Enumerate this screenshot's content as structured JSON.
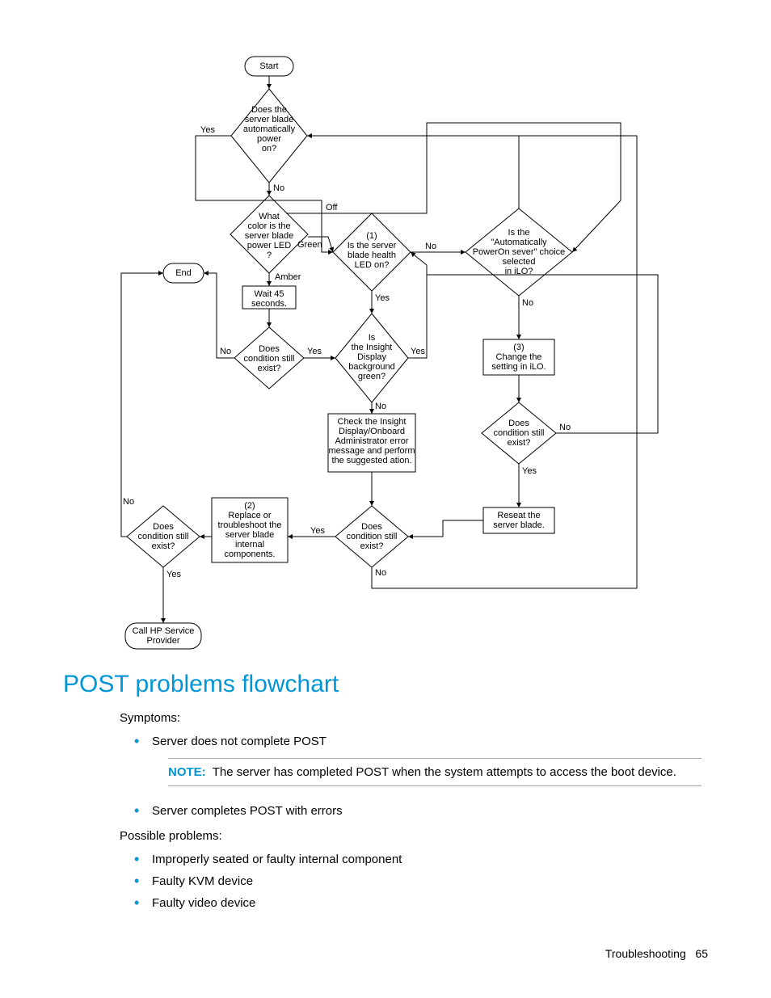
{
  "flow": {
    "start": "Start",
    "q_autopower": "Does the\nserver blade\nautomatically\npower\non?",
    "q_ledcolor": "What\ncolor is the\nserver blade\npower LED\n?",
    "end": "End",
    "wait": "Wait 45\nseconds.",
    "q_condexist1": "Does\ncondition still\nexist?",
    "q_health": "(1)\nIs the server\nblade health\nLED on?",
    "q_iloset": "Is the\n\"Automatically\nPowerOn sever\" choice\nselected\nin iLO?",
    "q_insight": "Is\nthe Insight\nDisplay\nbackground\ngreen?",
    "changeilo": "(3)\nChange the\nsetting in iLO.",
    "checkins": "Check the Insight\nDisplay/Onboard\nAdministrator error\nmessage and perform\nthe suggested ation.",
    "q_condexist_ilo": "Does\ncondition still\nexist?",
    "replace": "(2)\nReplace or\ntroubleshoot the\nserver blade\ninternal\ncomponents.",
    "q_condexist2": "Does\ncondition still\nexist?",
    "reseat": "Reseat the\nserver blade.",
    "q_condexist3": "Does\ncondition still\nexist?",
    "callhp": "Call HP Service\nProvider",
    "lbl": {
      "yes": "Yes",
      "no": "No",
      "off": "Off",
      "green": "Green",
      "amber": "Amber"
    }
  },
  "heading": "POST problems flowchart",
  "symptoms_label": "Symptoms:",
  "symptoms": [
    "Server does not complete POST",
    "Server completes POST with errors"
  ],
  "note_label": "NOTE:",
  "note": "The server has completed POST when the system attempts to access the boot device.",
  "problems_label": "Possible problems:",
  "problems": [
    "Improperly seated or faulty internal component",
    "Faulty KVM device",
    "Faulty video device"
  ],
  "footer_section": "Troubleshooting",
  "footer_page": "65",
  "chart_data": {
    "type": "flowchart",
    "nodes": [
      {
        "id": "start",
        "shape": "terminator",
        "text": "Start"
      },
      {
        "id": "q_autopower",
        "shape": "decision",
        "text": "Does the server blade automatically power on?"
      },
      {
        "id": "q_ledcolor",
        "shape": "decision",
        "text": "What color is the server blade power LED ?"
      },
      {
        "id": "end",
        "shape": "terminator",
        "text": "End"
      },
      {
        "id": "wait",
        "shape": "process",
        "text": "Wait 45 seconds."
      },
      {
        "id": "q_condexist1",
        "shape": "decision",
        "text": "Does condition still exist?"
      },
      {
        "id": "q_health",
        "shape": "decision",
        "text": "(1) Is the server blade health LED on?"
      },
      {
        "id": "q_iloset",
        "shape": "decision",
        "text": "Is the \"Automatically PowerOn sever\" choice selected in iLO?"
      },
      {
        "id": "q_insight",
        "shape": "decision",
        "text": "Is the Insight Display background green?"
      },
      {
        "id": "changeilo",
        "shape": "process",
        "text": "(3) Change the setting in iLO."
      },
      {
        "id": "checkins",
        "shape": "process",
        "text": "Check the Insight Display/Onboard Administrator error message and perform the suggested ation."
      },
      {
        "id": "q_condexist_ilo",
        "shape": "decision",
        "text": "Does condition still exist?"
      },
      {
        "id": "replace",
        "shape": "process",
        "text": "(2) Replace or troubleshoot the server blade internal components."
      },
      {
        "id": "q_condexist2",
        "shape": "decision",
        "text": "Does condition still exist?"
      },
      {
        "id": "reseat",
        "shape": "process",
        "text": "Reseat the server blade."
      },
      {
        "id": "q_condexist3",
        "shape": "decision",
        "text": "Does condition still exist?"
      },
      {
        "id": "callhp",
        "shape": "terminator",
        "text": "Call HP Service Provider"
      }
    ],
    "edges": [
      {
        "from": "start",
        "to": "q_autopower"
      },
      {
        "from": "q_autopower",
        "to": "q_health",
        "label": "Yes",
        "note": "via left loop to node (1)"
      },
      {
        "from": "q_autopower",
        "to": "q_ledcolor",
        "label": "No"
      },
      {
        "from": "q_ledcolor",
        "to": "q_iloset",
        "label": "Off"
      },
      {
        "from": "q_ledcolor",
        "to": "q_health",
        "label": "Green"
      },
      {
        "from": "q_ledcolor",
        "to": "wait",
        "label": "Amber"
      },
      {
        "from": "wait",
        "to": "q_condexist1"
      },
      {
        "from": "q_condexist1",
        "to": "end",
        "label": "No"
      },
      {
        "from": "q_condexist1",
        "to": "q_insight",
        "label": "Yes"
      },
      {
        "from": "q_health",
        "to": "q_insight",
        "label": "Yes"
      },
      {
        "from": "q_health",
        "to": "q_iloset",
        "label": "No"
      },
      {
        "from": "q_iloset",
        "to": "q_autopower",
        "label": "Yes",
        "note": "loops back"
      },
      {
        "from": "q_iloset",
        "to": "changeilo",
        "label": "No"
      },
      {
        "from": "changeilo",
        "to": "q_condexist_ilo"
      },
      {
        "from": "q_condexist_ilo",
        "to": "reseat",
        "label": "Yes"
      },
      {
        "from": "q_condexist_ilo",
        "to": "q_health",
        "label": "No",
        "note": "loops back to (1)"
      },
      {
        "from": "q_insight",
        "to": "q_health",
        "label": "Yes",
        "note": "loops back to (1)"
      },
      {
        "from": "q_insight",
        "to": "checkins",
        "label": "No"
      },
      {
        "from": "checkins",
        "to": "q_condexist2"
      },
      {
        "from": "reseat",
        "to": "q_condexist2"
      },
      {
        "from": "q_condexist2",
        "to": "replace",
        "label": "Yes"
      },
      {
        "from": "q_condexist2",
        "to": "q_autopower",
        "label": "No",
        "note": "loops back"
      },
      {
        "from": "replace",
        "to": "q_condexist3"
      },
      {
        "from": "q_condexist3",
        "to": "end",
        "label": "No"
      },
      {
        "from": "q_condexist3",
        "to": "callhp",
        "label": "Yes"
      }
    ]
  }
}
